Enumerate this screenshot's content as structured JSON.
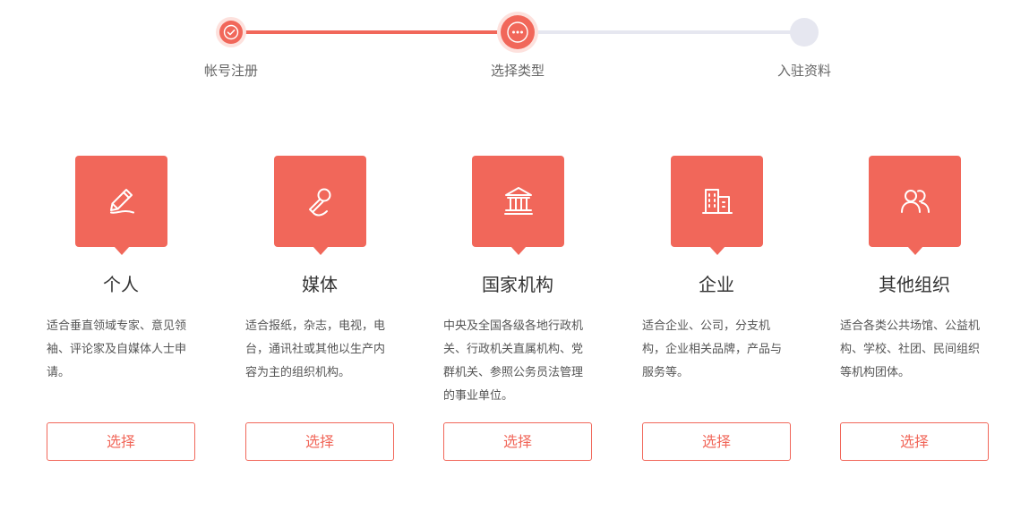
{
  "colors": {
    "accent": "#f1675a",
    "accent_light": "#fde1dd",
    "inactive": "#e6e7f0"
  },
  "steps": [
    {
      "label": "帐号注册",
      "state": "done",
      "icon": "check-icon"
    },
    {
      "label": "选择类型",
      "state": "current",
      "icon": "more-dots-icon"
    },
    {
      "label": "入驻资料",
      "state": "todo"
    }
  ],
  "cards": [
    {
      "title": "个人",
      "description": "适合垂直领域专家、意见领袖、评论家及自媒体人士申请。",
      "button": "选择",
      "icon": "pen-icon"
    },
    {
      "title": "媒体",
      "description": "适合报纸，杂志，电视，电台，通讯社或其他以生产内容为主的组织机构。",
      "button": "选择",
      "icon": "microphone-icon"
    },
    {
      "title": "国家机构",
      "description": "中央及全国各级各地行政机关、行政机关直属机构、党群机关、参照公务员法管理的事业单位。",
      "button": "选择",
      "icon": "government-building-icon"
    },
    {
      "title": "企业",
      "description": "适合企业、公司，分支机构，企业相关品牌，产品与服务等。",
      "button": "选择",
      "icon": "office-building-icon"
    },
    {
      "title": "其他组织",
      "description": "适合各类公共场馆、公益机构、学校、社团、民间组织等机构团体。",
      "button": "选择",
      "icon": "people-icon"
    }
  ]
}
